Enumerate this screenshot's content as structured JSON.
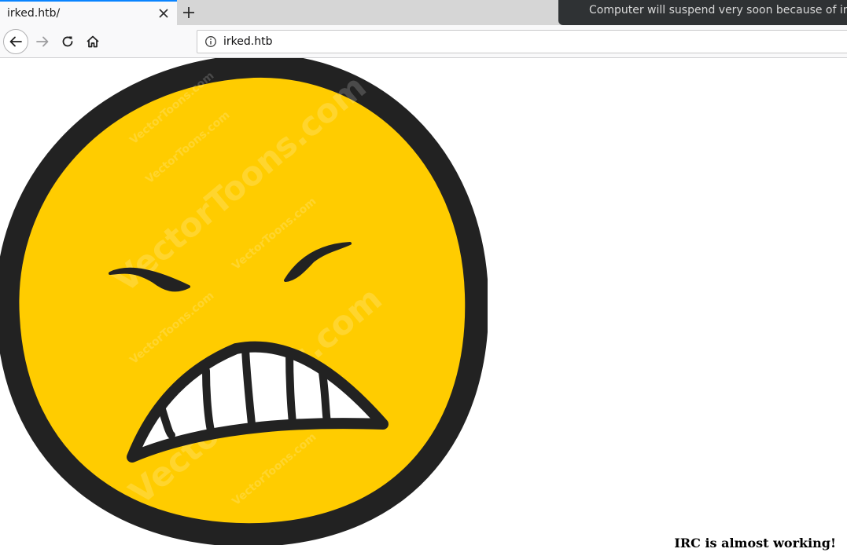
{
  "tab": {
    "title": "irked.htb/"
  },
  "notification": {
    "text": "Computer will suspend very soon because of inactivity."
  },
  "urlbar": {
    "url": "irked.htb"
  },
  "page": {
    "image_watermark": "VectorToons.com",
    "message": "IRC is almost working!"
  },
  "colors": {
    "face_fill": "#ffcc00",
    "face_outline": "#222222",
    "tab_accent": "#0a84ff"
  }
}
